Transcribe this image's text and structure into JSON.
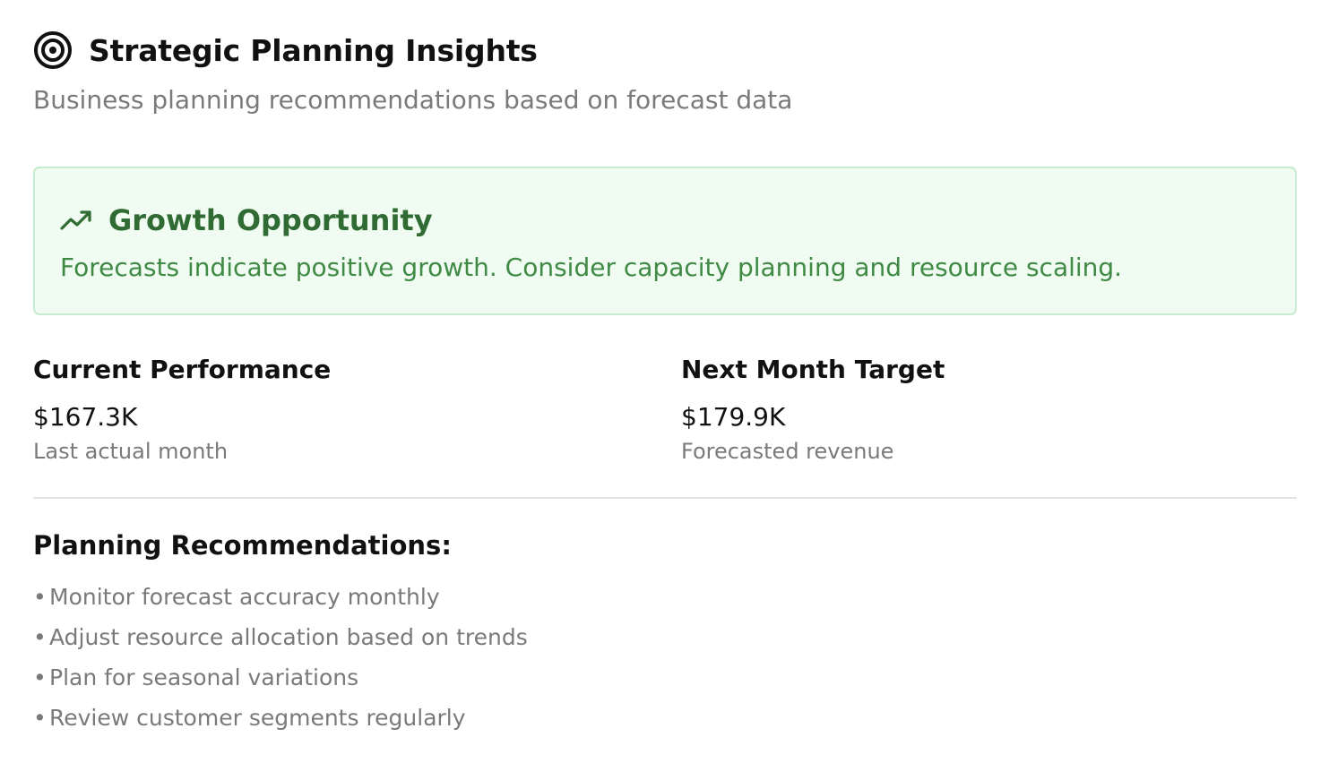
{
  "header": {
    "icon": "target-icon",
    "title": "Strategic Planning Insights",
    "subtitle": "Business planning recommendations based on forecast data"
  },
  "alert": {
    "icon": "trending-up-icon",
    "title": "Growth Opportunity",
    "message": "Forecasts indicate positive growth. Consider capacity planning and resource scaling.",
    "colors": {
      "background": "#f0fbf1",
      "border": "#c8ecd0",
      "title": "#2f6b33",
      "text": "#3f8a44"
    }
  },
  "metrics": [
    {
      "label": "Current Performance",
      "value": "$167.3K",
      "caption": "Last actual month"
    },
    {
      "label": "Next Month Target",
      "value": "$179.9K",
      "caption": "Forecasted revenue"
    }
  ],
  "recommendations": {
    "title": "Planning Recommendations:",
    "bullet": "•",
    "items": [
      "Monitor forecast accuracy monthly",
      "Adjust resource allocation based on trends",
      "Plan for seasonal variations",
      "Review customer segments regularly"
    ]
  }
}
